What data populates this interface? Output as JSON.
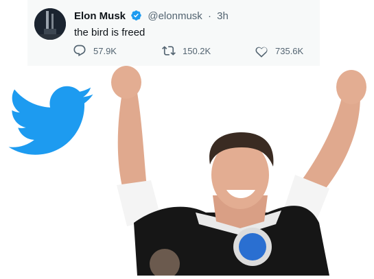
{
  "tweet": {
    "name": "Elon Musk",
    "handle": "@elonmusk",
    "separator": "·",
    "time": "3h",
    "text": "the bird is freed",
    "replies": "57.9K",
    "retweets": "150.2K",
    "likes": "735.6K"
  },
  "icons": {
    "verified": "verified-badge-icon",
    "reply": "reply-icon",
    "retweet": "retweet-icon",
    "like": "heart-icon",
    "logo": "twitter-bird-icon"
  },
  "colors": {
    "twitter_blue": "#1d9bf0",
    "text": "#0f1419",
    "muted": "#536471"
  }
}
